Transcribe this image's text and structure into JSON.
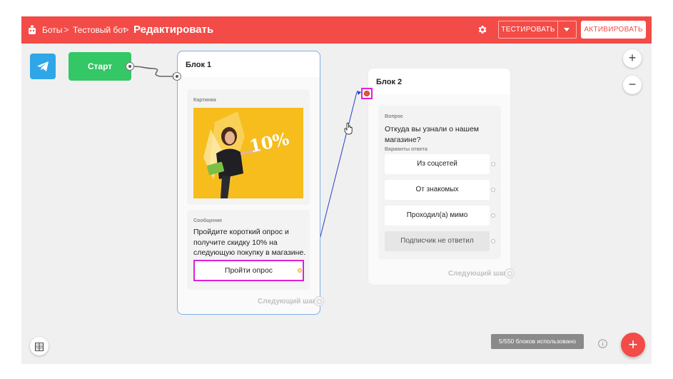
{
  "header": {
    "breadcrumb_bots": "Боты",
    "breadcrumb_bot": "Тестовый бот",
    "separator": ">",
    "title": "Редактировать",
    "test_label": "ТЕСТИРОВАТЬ",
    "activate_label": "АКТИВИРОВАТЬ",
    "settings_icon": "gear-icon",
    "logo_icon": "bot-icon"
  },
  "canvas": {
    "start_label": "Старт",
    "channel_icon": "telegram-icon",
    "zoom_in": "+",
    "zoom_out": "−"
  },
  "block1": {
    "title": "Блок 1",
    "image_label": "Картинка",
    "image_badge": "10%",
    "message_label": "Сообщение",
    "message_text": "Пройдите короткий опрос и получите скидку 10% на следующую покупку в магазине.",
    "button_label": "Пройти опрос",
    "next_step": "Следующий шаг"
  },
  "block2": {
    "title": "Блок 2",
    "question_label": "Вопрос",
    "question_text": "Откуда вы узнали о нашем магазине?",
    "answers_label": "Варианты ответа",
    "options": [
      "Из соцсетей",
      "От знакомых",
      "Проходил(а) мимо",
      "Подписчик не ответил"
    ],
    "next_step": "Следующий шаг"
  },
  "footer": {
    "usage": "5/550 блоков использовано",
    "info_icon": "info-icon",
    "add_label": "+",
    "grid_icon": "grid-icon"
  },
  "colors": {
    "brand": "#f34b47",
    "start": "#33c765",
    "telegram": "#2ea6e8",
    "highlight": "#e020d8",
    "selection": "#7fb0e6",
    "connector": "#2a3fc7"
  }
}
